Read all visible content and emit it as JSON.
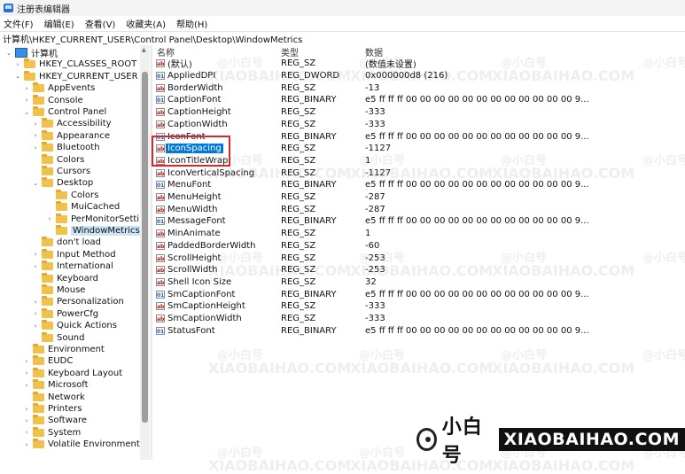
{
  "window": {
    "title": "注册表编辑器"
  },
  "menubar": {
    "items": [
      "文件(F)",
      "编辑(E)",
      "查看(V)",
      "收藏夹(A)",
      "帮助(H)"
    ]
  },
  "address": {
    "path": "计算机\\HKEY_CURRENT_USER\\Control Panel\\Desktop\\WindowMetrics"
  },
  "tree": {
    "items": [
      {
        "label": "计算机",
        "level": 0,
        "chev": "⌄",
        "icon": "computer-icon"
      },
      {
        "label": "HKEY_CLASSES_ROOT",
        "level": 1,
        "chev": "›",
        "icon": "folder-icon"
      },
      {
        "label": "HKEY_CURRENT_USER",
        "level": 1,
        "chev": "⌄",
        "icon": "folder-icon"
      },
      {
        "label": "AppEvents",
        "level": 2,
        "chev": "›",
        "icon": "folder-icon"
      },
      {
        "label": "Console",
        "level": 2,
        "chev": "›",
        "icon": "folder-icon"
      },
      {
        "label": "Control Panel",
        "level": 2,
        "chev": "⌄",
        "icon": "folder-icon"
      },
      {
        "label": "Accessibility",
        "level": 3,
        "chev": "›",
        "icon": "folder-icon"
      },
      {
        "label": "Appearance",
        "level": 3,
        "chev": "›",
        "icon": "folder-icon"
      },
      {
        "label": "Bluetooth",
        "level": 3,
        "chev": "›",
        "icon": "folder-icon"
      },
      {
        "label": "Colors",
        "level": 3,
        "chev": "",
        "icon": "folder-icon"
      },
      {
        "label": "Cursors",
        "level": 3,
        "chev": "",
        "icon": "folder-icon"
      },
      {
        "label": "Desktop",
        "level": 3,
        "chev": "⌄",
        "icon": "folder-icon"
      },
      {
        "label": "Colors",
        "level": 4,
        "chev": "",
        "icon": "folder-icon"
      },
      {
        "label": "MuiCached",
        "level": 4,
        "chev": "",
        "icon": "folder-icon"
      },
      {
        "label": "PerMonitorSettin",
        "level": 4,
        "chev": "›",
        "icon": "folder-icon"
      },
      {
        "label": "WindowMetrics",
        "level": 4,
        "chev": "",
        "icon": "folder-icon",
        "selected": true
      },
      {
        "label": "don't load",
        "level": 3,
        "chev": "",
        "icon": "folder-icon"
      },
      {
        "label": "Input Method",
        "level": 3,
        "chev": "›",
        "icon": "folder-icon"
      },
      {
        "label": "International",
        "level": 3,
        "chev": "›",
        "icon": "folder-icon"
      },
      {
        "label": "Keyboard",
        "level": 3,
        "chev": "",
        "icon": "folder-icon"
      },
      {
        "label": "Mouse",
        "level": 3,
        "chev": "",
        "icon": "folder-icon"
      },
      {
        "label": "Personalization",
        "level": 3,
        "chev": "›",
        "icon": "folder-icon"
      },
      {
        "label": "PowerCfg",
        "level": 3,
        "chev": "›",
        "icon": "folder-icon"
      },
      {
        "label": "Quick Actions",
        "level": 3,
        "chev": "›",
        "icon": "folder-icon"
      },
      {
        "label": "Sound",
        "level": 3,
        "chev": "",
        "icon": "folder-icon"
      },
      {
        "label": "Environment",
        "level": 2,
        "chev": "",
        "icon": "folder-icon"
      },
      {
        "label": "EUDC",
        "level": 2,
        "chev": "›",
        "icon": "folder-icon"
      },
      {
        "label": "Keyboard Layout",
        "level": 2,
        "chev": "›",
        "icon": "folder-icon"
      },
      {
        "label": "Microsoft",
        "level": 2,
        "chev": "›",
        "icon": "folder-icon"
      },
      {
        "label": "Network",
        "level": 2,
        "chev": "",
        "icon": "folder-icon"
      },
      {
        "label": "Printers",
        "level": 2,
        "chev": "›",
        "icon": "folder-icon"
      },
      {
        "label": "Software",
        "level": 2,
        "chev": "›",
        "icon": "folder-icon"
      },
      {
        "label": "System",
        "level": 2,
        "chev": "›",
        "icon": "folder-icon"
      },
      {
        "label": "Volatile Environment",
        "level": 2,
        "chev": "›",
        "icon": "folder-icon"
      }
    ]
  },
  "list": {
    "columns": {
      "name": "名称",
      "type": "类型",
      "data": "数据"
    },
    "rows": [
      {
        "name": "(默认)",
        "type": "REG_SZ",
        "data": "(数值未设置)",
        "icon": "string-value-icon"
      },
      {
        "name": "AppliedDPI",
        "type": "REG_DWORD",
        "data": "0x000000d8 (216)",
        "icon": "binary-value-icon"
      },
      {
        "name": "BorderWidth",
        "type": "REG_SZ",
        "data": "-13",
        "icon": "string-value-icon"
      },
      {
        "name": "CaptionFont",
        "type": "REG_BINARY",
        "data": "e5 ff ff ff 00 00 00 00 00 00 00 00 00 00 00 00 9...",
        "icon": "binary-value-icon"
      },
      {
        "name": "CaptionHeight",
        "type": "REG_SZ",
        "data": "-333",
        "icon": "string-value-icon"
      },
      {
        "name": "CaptionWidth",
        "type": "REG_SZ",
        "data": "-333",
        "icon": "string-value-icon"
      },
      {
        "name": "IconFont",
        "type": "REG_BINARY",
        "data": "e5 ff ff ff 00 00 00 00 00 00 00 00 00 00 00 00 9...",
        "icon": "binary-value-icon"
      },
      {
        "name": "IconSpacing",
        "type": "REG_SZ",
        "data": "-1127",
        "icon": "string-value-icon",
        "selected": true
      },
      {
        "name": "IconTitleWrap",
        "type": "REG_SZ",
        "data": "1",
        "icon": "string-value-icon"
      },
      {
        "name": "IconVerticalSpacing",
        "type": "REG_SZ",
        "data": "-1127",
        "icon": "string-value-icon"
      },
      {
        "name": "MenuFont",
        "type": "REG_BINARY",
        "data": "e5 ff ff ff 00 00 00 00 00 00 00 00 00 00 00 00 9...",
        "icon": "binary-value-icon"
      },
      {
        "name": "MenuHeight",
        "type": "REG_SZ",
        "data": "-287",
        "icon": "string-value-icon"
      },
      {
        "name": "MenuWidth",
        "type": "REG_SZ",
        "data": "-287",
        "icon": "string-value-icon"
      },
      {
        "name": "MessageFont",
        "type": "REG_BINARY",
        "data": "e5 ff ff ff 00 00 00 00 00 00 00 00 00 00 00 00 9...",
        "icon": "binary-value-icon"
      },
      {
        "name": "MinAnimate",
        "type": "REG_SZ",
        "data": "1",
        "icon": "string-value-icon"
      },
      {
        "name": "PaddedBorderWidth",
        "type": "REG_SZ",
        "data": "-60",
        "icon": "string-value-icon"
      },
      {
        "name": "ScrollHeight",
        "type": "REG_SZ",
        "data": "-253",
        "icon": "string-value-icon"
      },
      {
        "name": "ScrollWidth",
        "type": "REG_SZ",
        "data": "-253",
        "icon": "string-value-icon"
      },
      {
        "name": "Shell Icon Size",
        "type": "REG_SZ",
        "data": "32",
        "icon": "string-value-icon"
      },
      {
        "name": "SmCaptionFont",
        "type": "REG_BINARY",
        "data": "e5 ff ff ff 00 00 00 00 00 00 00 00 00 00 00 00 9...",
        "icon": "binary-value-icon"
      },
      {
        "name": "SmCaptionHeight",
        "type": "REG_SZ",
        "data": "-333",
        "icon": "string-value-icon"
      },
      {
        "name": "SmCaptionWidth",
        "type": "REG_SZ",
        "data": "-333",
        "icon": "string-value-icon"
      },
      {
        "name": "StatusFont",
        "type": "REG_BINARY",
        "data": "e5 ff ff ff 00 00 00 00 00 00 00 00 00 00 00 00 9...",
        "icon": "binary-value-icon"
      }
    ]
  },
  "watermark": {
    "text_en": "XIAOBAIHAO.COM",
    "text_cn": "@小白号"
  },
  "brand": {
    "cn": "小白号",
    "en": "XIAOBAIHAO.COM"
  },
  "colors": {
    "selection": "#0078d7",
    "tree_selection": "#cce4f7",
    "highlight_box": "#d6262e",
    "folder": "#f1c24b"
  }
}
